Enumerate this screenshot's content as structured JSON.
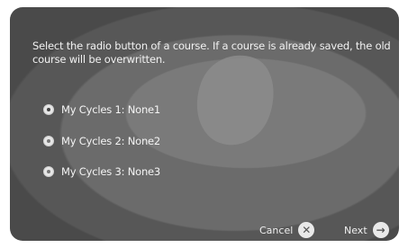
{
  "dialog": {
    "message": "Select the radio button of a course. If a course is already saved, the old course will be overwritten."
  },
  "options": [
    {
      "label": "My Cycles 1: None1",
      "selected": true
    },
    {
      "label": "My Cycles 2: None2",
      "selected": false
    },
    {
      "label": "My Cycles 3: None3",
      "selected": false
    }
  ],
  "footer": {
    "cancel_label": "Cancel",
    "cancel_icon": "close-icon",
    "next_label": "Next",
    "next_icon": "arrow-right-icon"
  }
}
